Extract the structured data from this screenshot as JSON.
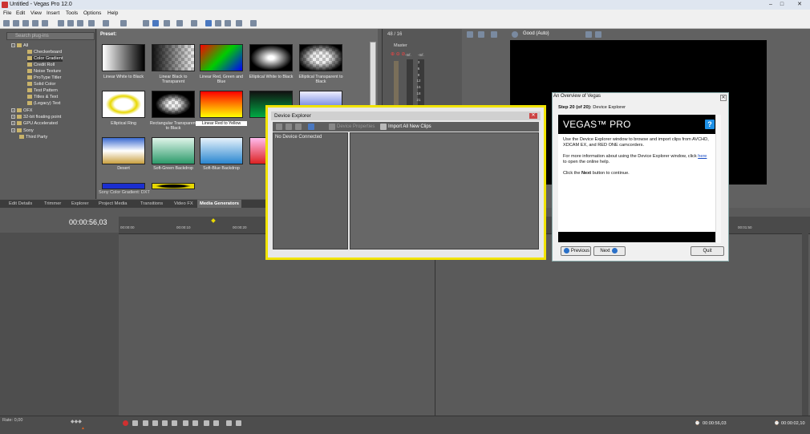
{
  "window": {
    "title": "Untitled - Vegas Pro 12.0",
    "controls": [
      "–",
      "□",
      "✕"
    ]
  },
  "menu": [
    "File",
    "Edit",
    "View",
    "Insert",
    "Tools",
    "Options",
    "Help"
  ],
  "explorer": {
    "search_placeholder": "Search plug-ins",
    "items": [
      "All",
      "Checkerboard",
      "Color Gradient",
      "Credit Roll",
      "Noise Texture",
      "ProType Titler",
      "Solid Color",
      "Test Pattern",
      "Titles & Text",
      "(Legacy) Text",
      "OFX",
      "32-bit floating point",
      "GPU Accelerated",
      "Sony",
      "Third Party"
    ]
  },
  "presets": {
    "label": "Preset:",
    "items": [
      {
        "label": "Linear White to Black"
      },
      {
        "label": "Linear Black to Transparent"
      },
      {
        "label": "Linear Red, Green and Blue"
      },
      {
        "label": "Elliptical White to Black"
      },
      {
        "label": "Elliptical Transparent to Black"
      },
      {
        "label": "Elliptical Ring"
      },
      {
        "label": "Rectangular Transparent to Black"
      },
      {
        "label": "Linear Red to Yellow"
      },
      {
        "label": "Linear"
      },
      {
        "label": ""
      },
      {
        "label": "Desert"
      },
      {
        "label": "Soft-Green Backdrop"
      },
      {
        "label": "Soft-Blue Backdrop"
      },
      {
        "label": "Soft-R"
      }
    ],
    "status": "Sony Color Gradient: DXT"
  },
  "tabs": [
    "Edit Details",
    "Trimmer",
    "Explorer",
    "Project Media",
    "Transitions",
    "Video FX",
    "Media Generators"
  ],
  "mixer": {
    "header": "48 / 16",
    "master": "Master",
    "db": [
      "-Inf.",
      "-Inf.",
      "3",
      "6",
      "9",
      "12",
      "15",
      "18",
      "21",
      "24",
      "27",
      "30"
    ]
  },
  "preview": {
    "quality": "Good (Auto)"
  },
  "timeline": {
    "timecode": "00:00:56,03",
    "ticks": [
      "00:00:00",
      "00:00:10",
      "00:00:20",
      "00:01:50"
    ],
    "rate": "Rate: 0,00",
    "end_time": "00:00:56,03",
    "total": "00:00:02,10"
  },
  "device_explorer": {
    "title": "Device Explorer",
    "device_properties": "Device Properties",
    "import_all": "Import All New Clips",
    "no_device": "No Device Connected"
  },
  "overview": {
    "title": "An Overview of Vegas",
    "step_prefix": "Step 20 (of 20):",
    "step_name": "Device Explorer",
    "logo": "VEGAS™ PRO",
    "help": "?",
    "p1": "Use the Device Explorer window to browse and import clips from AVCHD, XDCAM EX, and RED ONE camcorders.",
    "p2_a": "For more information about using the Device Explorer window, click",
    "p2_link": "here",
    "p2_b": "to open the online help.",
    "p3_a": "Click the",
    "p3_bold": "Next",
    "p3_b": "button to continue.",
    "prev": "Previous",
    "next": "Next",
    "quit": "Quit"
  }
}
